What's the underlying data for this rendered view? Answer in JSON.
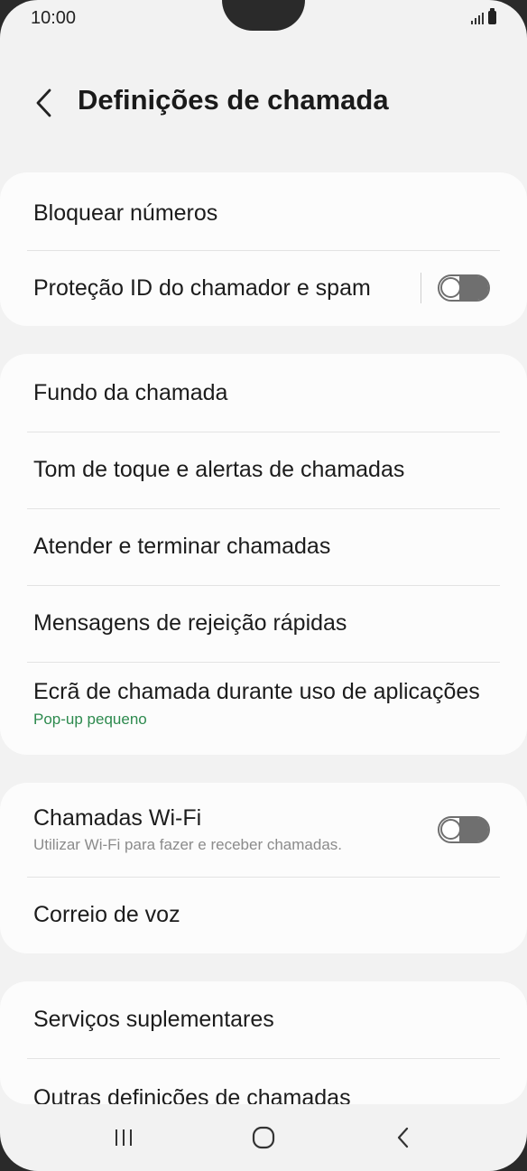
{
  "status_bar": {
    "time": "10:00"
  },
  "header": {
    "title": "Definições de chamada"
  },
  "sections": [
    {
      "items": [
        {
          "title": "Bloquear números"
        },
        {
          "title": "Proteção ID do chamador e spam",
          "toggle": false
        }
      ]
    },
    {
      "items": [
        {
          "title": "Fundo da chamada"
        },
        {
          "title": "Tom de toque e alertas de chamadas"
        },
        {
          "title": "Atender e terminar chamadas"
        },
        {
          "title": "Mensagens de rejeição rápidas"
        },
        {
          "title": "Ecrã de chamada durante uso de aplicações",
          "subtitle": "Pop-up pequeno"
        }
      ]
    },
    {
      "items": [
        {
          "title": "Chamadas Wi-Fi",
          "subtitle": "Utilizar Wi-Fi para fazer e receber chamadas.",
          "toggle": false
        },
        {
          "title": "Correio de voz"
        }
      ]
    },
    {
      "items": [
        {
          "title": "Serviços suplementares"
        },
        {
          "title": "Outras definições de chamadas"
        }
      ]
    }
  ],
  "colors": {
    "accent_green": "#2d8a4e",
    "toggle_off": "#6f6f6f"
  },
  "nav": {
    "recents_icon": "recents-icon",
    "home_icon": "home-icon",
    "back_icon": "back-icon"
  }
}
